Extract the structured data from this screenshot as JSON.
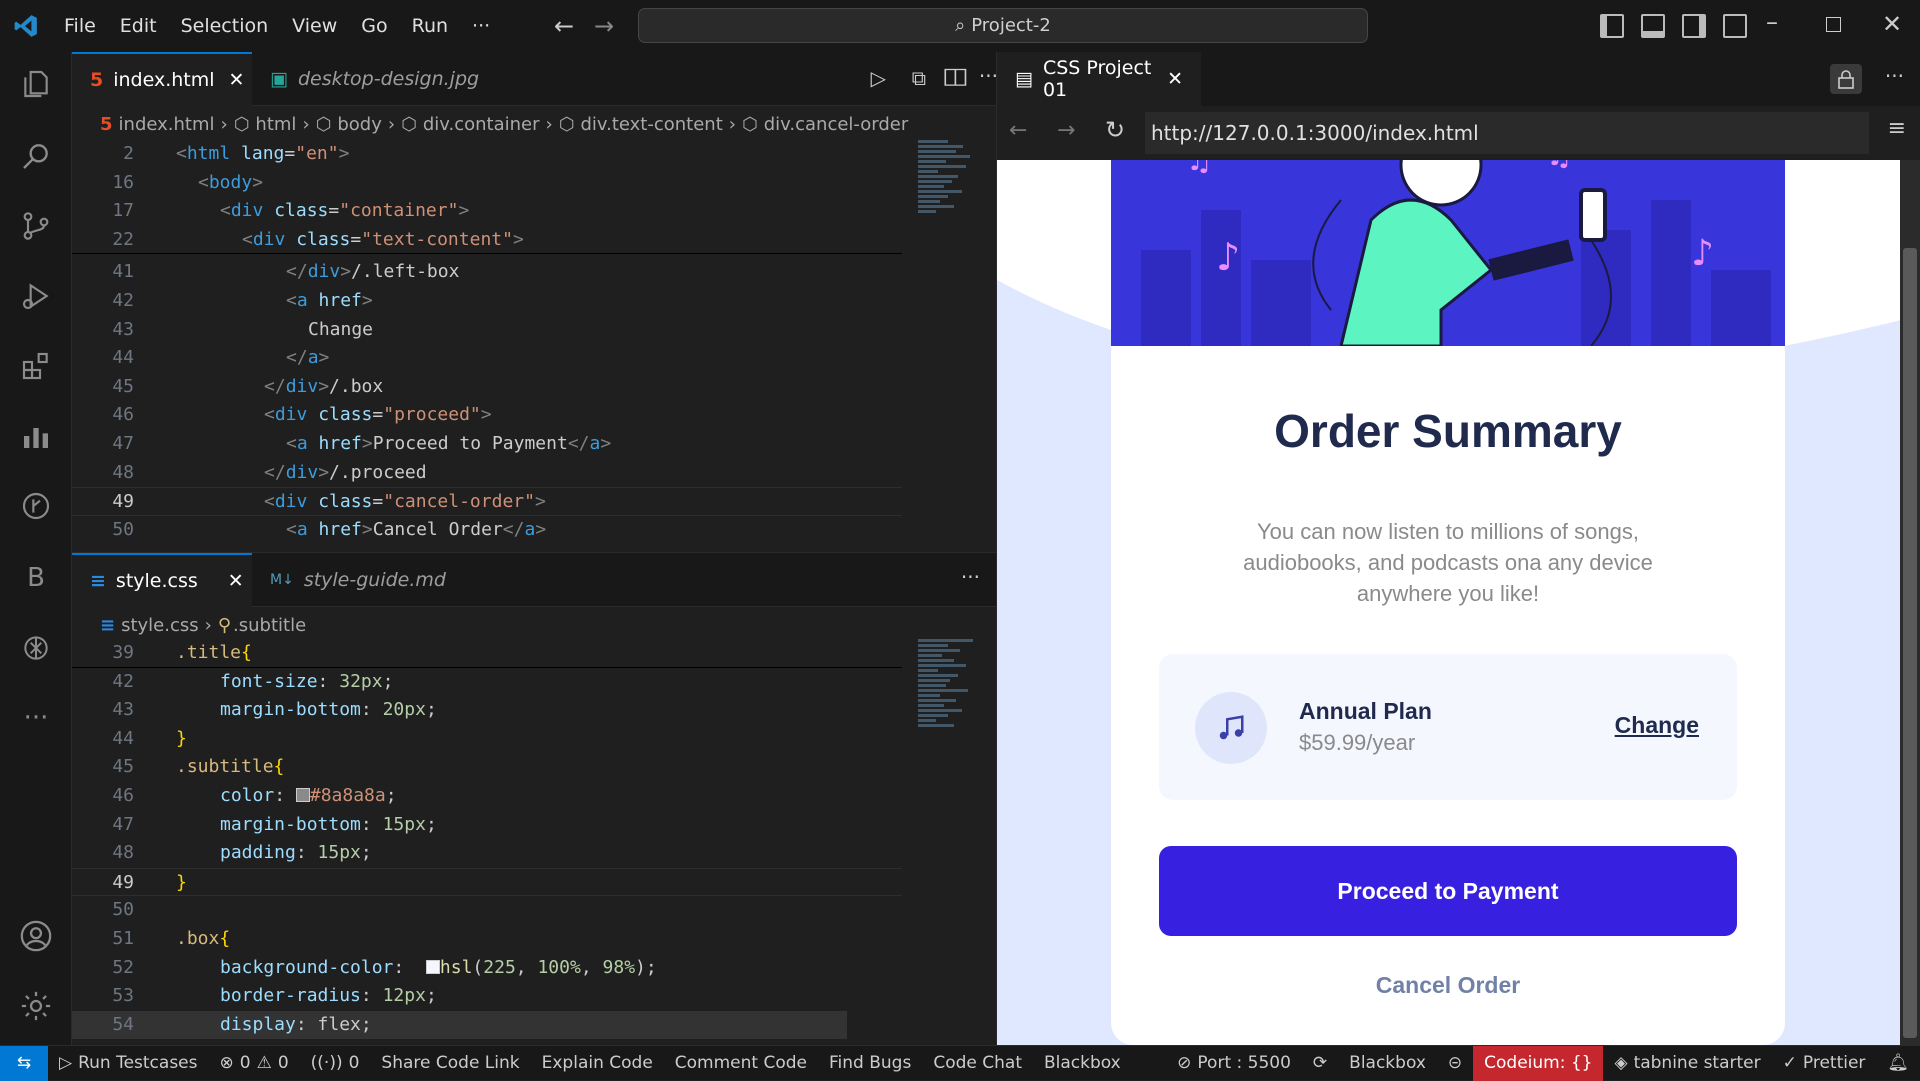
{
  "titlebar": {
    "menu": [
      "File",
      "Edit",
      "Selection",
      "View",
      "Go",
      "Run",
      "···"
    ],
    "search": "Project-2"
  },
  "editor1": {
    "tabs": [
      {
        "label": "index.html",
        "active": true
      },
      {
        "label": "desktop-design.jpg",
        "active": false
      }
    ],
    "breadcrumbs": [
      "index.html",
      "html",
      "body",
      "div.container",
      "div.text-content",
      "div.cancel-order"
    ]
  },
  "editor2": {
    "tabs": [
      {
        "label": "style.css",
        "active": true
      },
      {
        "label": "style-guide.md",
        "active": false
      }
    ],
    "breadcrumbs": [
      "style.css",
      "subtitle"
    ]
  },
  "preview": {
    "tab": "CSS Project 01",
    "url": "http://127.0.0.1:3000/index.html",
    "page": {
      "title": "Order Summary",
      "subtitle": "You can now listen to millions of songs, audiobooks, and podcasts ona any device anywhere you like!",
      "plan_name": "Annual Plan",
      "plan_price": "$59.99/year",
      "change": "Change",
      "proceed": "Proceed to Payment",
      "cancel": "Cancel Order"
    }
  },
  "statusbar": {
    "items": [
      "Run Testcases",
      "0",
      "0",
      "0",
      "Share Code Link",
      "Explain Code",
      "Comment Code",
      "Find Bugs",
      "Code Chat",
      "Blackbox",
      "Port : 5500",
      "Blackbox",
      "Codeium: {}",
      "tabnine starter",
      "Prettier"
    ]
  },
  "colors": {
    "accent": "#0078d4",
    "preview_primary": "#3820e0",
    "codeium": "#c4282e"
  }
}
